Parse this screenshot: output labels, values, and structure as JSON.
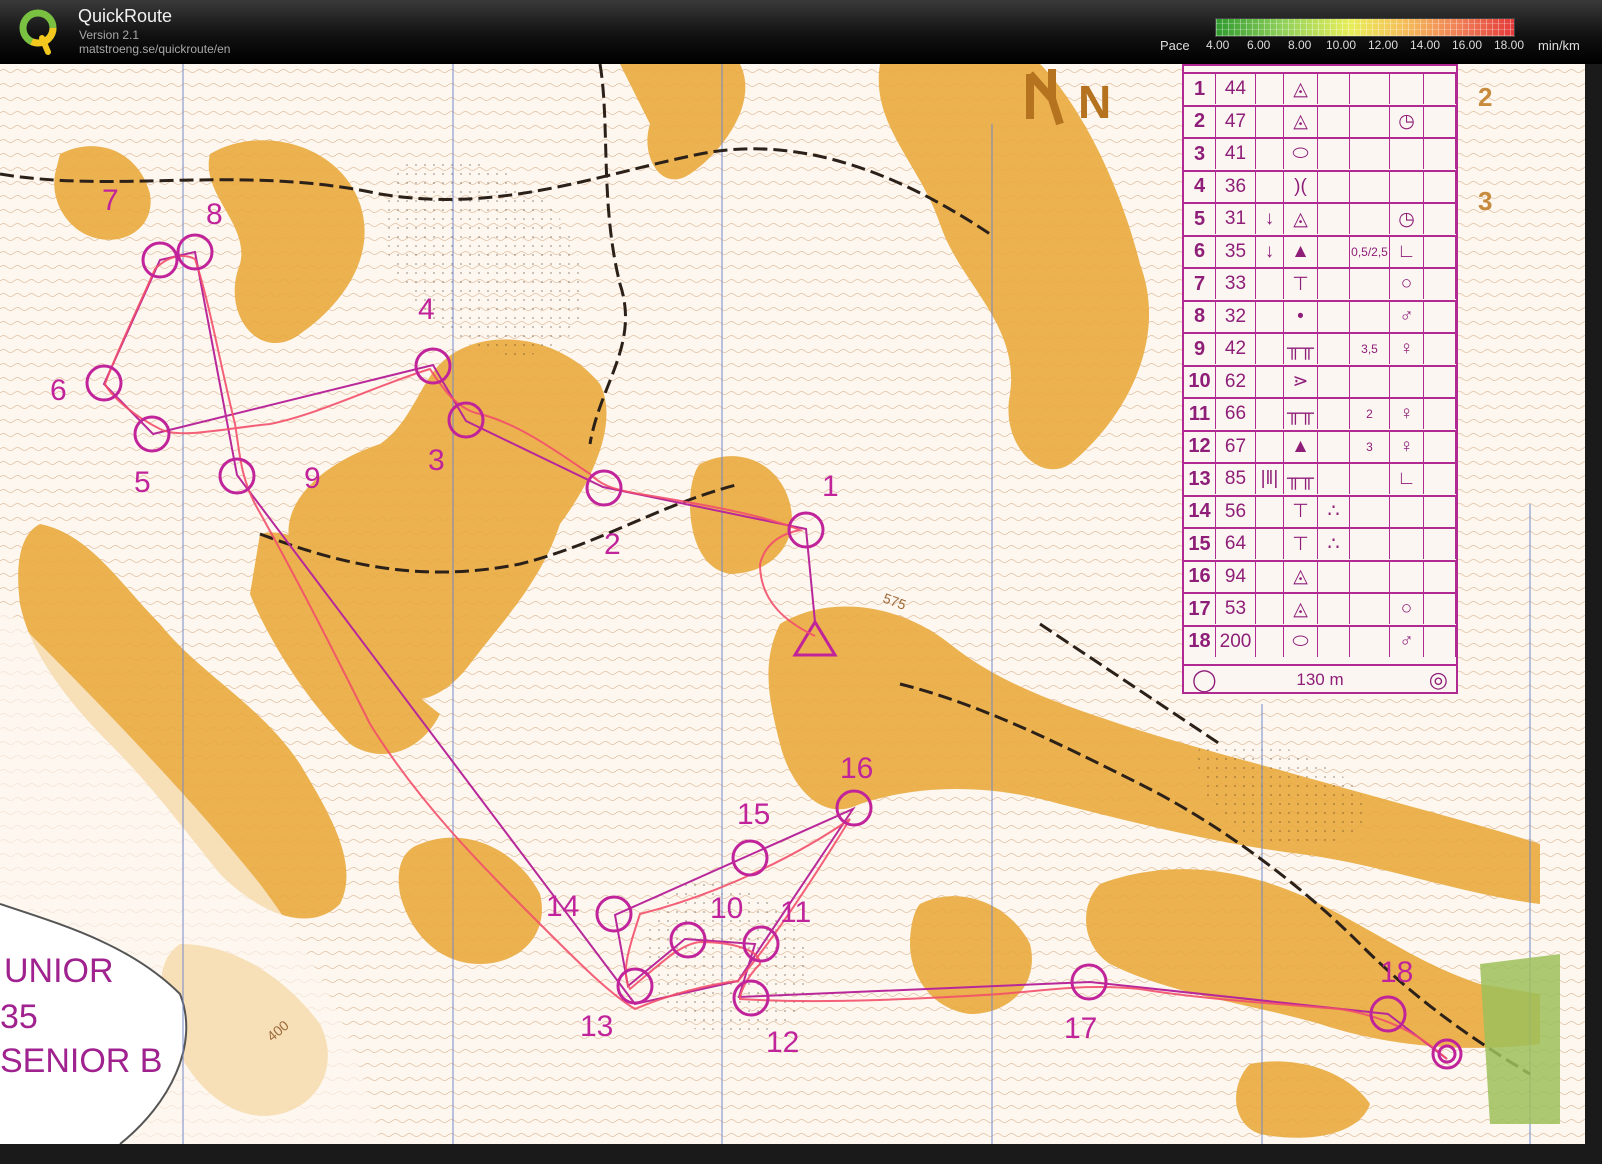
{
  "app": {
    "title": "QuickRoute",
    "version": "Version 2.1",
    "url": "matstroeng.se/quickroute/en"
  },
  "pace_legend": {
    "label": "Pace",
    "ticks": [
      "4.00",
      "6.00",
      "8.00",
      "10.00",
      "12.00",
      "14.00",
      "16.00",
      "18.00"
    ],
    "unit": "min/km",
    "colors": [
      "#2f9a2f",
      "#8fd05a",
      "#e8ee5a",
      "#f5c15a",
      "#f07e56",
      "#e43a3a"
    ]
  },
  "map": {
    "north_arrow": "N",
    "course_color": "#c0239a",
    "route_color": "#f2556a",
    "contour_label_1": "575",
    "contour_label_2": "400",
    "class_labels": [
      "UNIOR",
      "35",
      "SENIOR B"
    ],
    "controls": [
      {
        "number": "1"
      },
      {
        "number": "2"
      },
      {
        "number": "3"
      },
      {
        "number": "4"
      },
      {
        "number": "5"
      },
      {
        "number": "6"
      },
      {
        "number": "7"
      },
      {
        "number": "8"
      },
      {
        "number": "9"
      },
      {
        "number": "10"
      },
      {
        "number": "11"
      },
      {
        "number": "12"
      },
      {
        "number": "13"
      },
      {
        "number": "14"
      },
      {
        "number": "15"
      },
      {
        "number": "16"
      },
      {
        "number": "17"
      },
      {
        "number": "18"
      }
    ]
  },
  "control_descriptions": {
    "rows": [
      {
        "num": "1",
        "code": "44",
        "col3": "",
        "feature": "◬",
        "col5": "",
        "dim": "",
        "col7": ""
      },
      {
        "num": "2",
        "code": "47",
        "col3": "",
        "feature": "◬",
        "col5": "",
        "dim": "",
        "col7": "◷"
      },
      {
        "num": "3",
        "code": "41",
        "col3": "",
        "feature": "⬭",
        "col5": "",
        "dim": "",
        "col7": ""
      },
      {
        "num": "4",
        "code": "36",
        "col3": "",
        "feature": ")(",
        "col5": "",
        "dim": "",
        "col7": ""
      },
      {
        "num": "5",
        "code": "31",
        "col3": "↓",
        "feature": "◬",
        "col5": "",
        "dim": "",
        "col7": "◷"
      },
      {
        "num": "6",
        "code": "35",
        "col3": "↓",
        "feature": "▲",
        "col5": "",
        "dim": "0,5/2,5",
        "col7": "∟"
      },
      {
        "num": "7",
        "code": "33",
        "col3": "",
        "feature": "⊤",
        "col5": "",
        "dim": "",
        "col7": "○"
      },
      {
        "num": "8",
        "code": "32",
        "col3": "",
        "feature": "•",
        "col5": "",
        "dim": "",
        "col7": "♂"
      },
      {
        "num": "9",
        "code": "42",
        "col3": "",
        "feature": "╥╥",
        "col5": "",
        "dim": "3,5",
        "col7": "♀"
      },
      {
        "num": "10",
        "code": "62",
        "col3": "",
        "feature": "⋗",
        "col5": "",
        "dim": "",
        "col7": ""
      },
      {
        "num": "11",
        "code": "66",
        "col3": "",
        "feature": "╥╥",
        "col5": "",
        "dim": "2",
        "col7": "♀"
      },
      {
        "num": "12",
        "code": "67",
        "col3": "",
        "feature": "▲",
        "col5": "",
        "dim": "3",
        "col7": "♀"
      },
      {
        "num": "13",
        "code": "85",
        "col3": "|‖|",
        "feature": "╥╥",
        "col5": "",
        "dim": "",
        "col7": "∟"
      },
      {
        "num": "14",
        "code": "56",
        "col3": "",
        "feature": "⊤",
        "col5": "∴",
        "dim": "",
        "col7": ""
      },
      {
        "num": "15",
        "code": "64",
        "col3": "",
        "feature": "⊤",
        "col5": "∴",
        "dim": "",
        "col7": ""
      },
      {
        "num": "16",
        "code": "94",
        "col3": "",
        "feature": "◬",
        "col5": "",
        "dim": "",
        "col7": ""
      },
      {
        "num": "17",
        "code": "53",
        "col3": "",
        "feature": "◬",
        "col5": "",
        "dim": "",
        "col7": "○"
      },
      {
        "num": "18",
        "code": "200",
        "col3": "",
        "feature": "⬭",
        "col5": "",
        "dim": "",
        "col7": "♂"
      }
    ],
    "footer": "130 m",
    "side_numbers": [
      "2",
      "3"
    ]
  }
}
